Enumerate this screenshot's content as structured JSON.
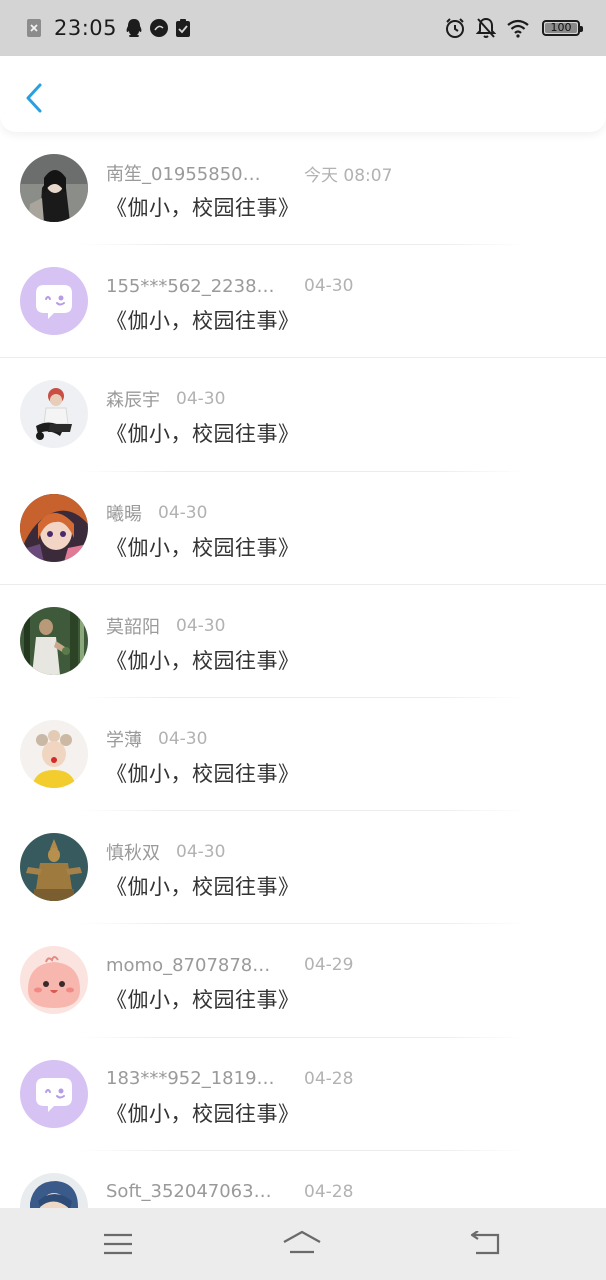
{
  "status_bar": {
    "time": "23:05",
    "battery": "100",
    "left_icons": [
      "close-notification-icon",
      "qq-icon",
      "jovi-icon",
      "clipboard-check-icon"
    ],
    "right_icons": [
      "alarm-icon",
      "bell-off-icon",
      "wifi-icon",
      "battery-icon"
    ]
  },
  "header": {
    "back_icon": "chevron-left-icon",
    "accent_color": "#2a9fe0"
  },
  "list": {
    "items": [
      {
        "name": "南笙_01955850…",
        "time": "今天 08:07",
        "title": "《伽小，校园往事》",
        "avatar": "photo-girl-dark-hair"
      },
      {
        "name": "155***562_2238…",
        "time": "04-30",
        "title": "《伽小，校园往事》",
        "avatar": "default-chat-bubble"
      },
      {
        "name": "森辰宇",
        "time": "04-30",
        "title": "《伽小，校园往事》",
        "avatar": "photo-sitting-person"
      },
      {
        "name": "曦暘",
        "time": "04-30",
        "title": "《伽小，校园往事》",
        "avatar": "anime-girl"
      },
      {
        "name": "莫韶阳",
        "time": "04-30",
        "title": "《伽小，校园往事》",
        "avatar": "photo-forest-girl"
      },
      {
        "name": "学薄",
        "time": "04-30",
        "title": "《伽小，校园往事》",
        "avatar": "photo-flower-crown-girl"
      },
      {
        "name": "慎秋双",
        "time": "04-30",
        "title": "《伽小，校园往事》",
        "avatar": "photo-statue"
      },
      {
        "name": "momo_8707878…",
        "time": "04-29",
        "title": "《伽小，校园往事》",
        "avatar": "cartoon-pink-blob"
      },
      {
        "name": "183***952_1819…",
        "time": "04-28",
        "title": "《伽小，校园往事》",
        "avatar": "default-chat-bubble"
      },
      {
        "name": "Soft_352047063…",
        "time": "04-28",
        "title": "",
        "avatar": "photo-blue-hair"
      }
    ]
  },
  "nav_bar": {
    "icons": [
      "menu-icon",
      "home-icon",
      "back-icon"
    ]
  }
}
